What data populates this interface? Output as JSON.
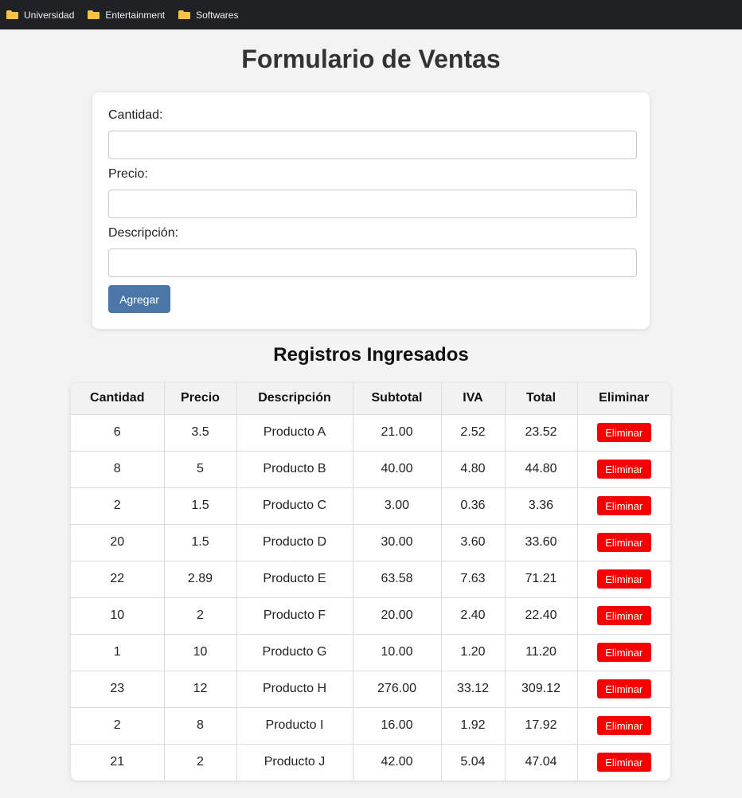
{
  "bookmarks": [
    {
      "label": "Universidad",
      "icon": "folder-icon"
    },
    {
      "label": "Entertainment",
      "icon": "folder-icon"
    },
    {
      "label": "Softwares",
      "icon": "folder-icon"
    }
  ],
  "page": {
    "title": "Formulario de Ventas",
    "records_title": "Registros Ingresados"
  },
  "form": {
    "cantidad_label": "Cantidad:",
    "cantidad_value": "",
    "precio_label": "Precio:",
    "precio_value": "",
    "descripcion_label": "Descripción:",
    "descripcion_value": "",
    "add_label": "Agregar"
  },
  "table": {
    "headers": [
      "Cantidad",
      "Precio",
      "Descripción",
      "Subtotal",
      "IVA",
      "Total",
      "Eliminar"
    ],
    "delete_label": "Eliminar",
    "rows": [
      {
        "cantidad": "6",
        "precio": "3.5",
        "descripcion": "Producto A",
        "subtotal": "21.00",
        "iva": "2.52",
        "total": "23.52"
      },
      {
        "cantidad": "8",
        "precio": "5",
        "descripcion": "Producto B",
        "subtotal": "40.00",
        "iva": "4.80",
        "total": "44.80"
      },
      {
        "cantidad": "2",
        "precio": "1.5",
        "descripcion": "Producto C",
        "subtotal": "3.00",
        "iva": "0.36",
        "total": "3.36"
      },
      {
        "cantidad": "20",
        "precio": "1.5",
        "descripcion": "Producto D",
        "subtotal": "30.00",
        "iva": "3.60",
        "total": "33.60"
      },
      {
        "cantidad": "22",
        "precio": "2.89",
        "descripcion": "Producto E",
        "subtotal": "63.58",
        "iva": "7.63",
        "total": "71.21"
      },
      {
        "cantidad": "10",
        "precio": "2",
        "descripcion": "Producto F",
        "subtotal": "20.00",
        "iva": "2.40",
        "total": "22.40"
      },
      {
        "cantidad": "1",
        "precio": "10",
        "descripcion": "Producto G",
        "subtotal": "10.00",
        "iva": "1.20",
        "total": "11.20"
      },
      {
        "cantidad": "23",
        "precio": "12",
        "descripcion": "Producto H",
        "subtotal": "276.00",
        "iva": "33.12",
        "total": "309.12"
      },
      {
        "cantidad": "2",
        "precio": "8",
        "descripcion": "Producto I",
        "subtotal": "16.00",
        "iva": "1.92",
        "total": "17.92"
      },
      {
        "cantidad": "21",
        "precio": "2",
        "descripcion": "Producto J",
        "subtotal": "42.00",
        "iva": "5.04",
        "total": "47.04"
      }
    ]
  },
  "colors": {
    "accent": "#4a76a8",
    "danger": "#f70000",
    "folder": "#f6c343",
    "bookmarks_bar": "#202124"
  }
}
